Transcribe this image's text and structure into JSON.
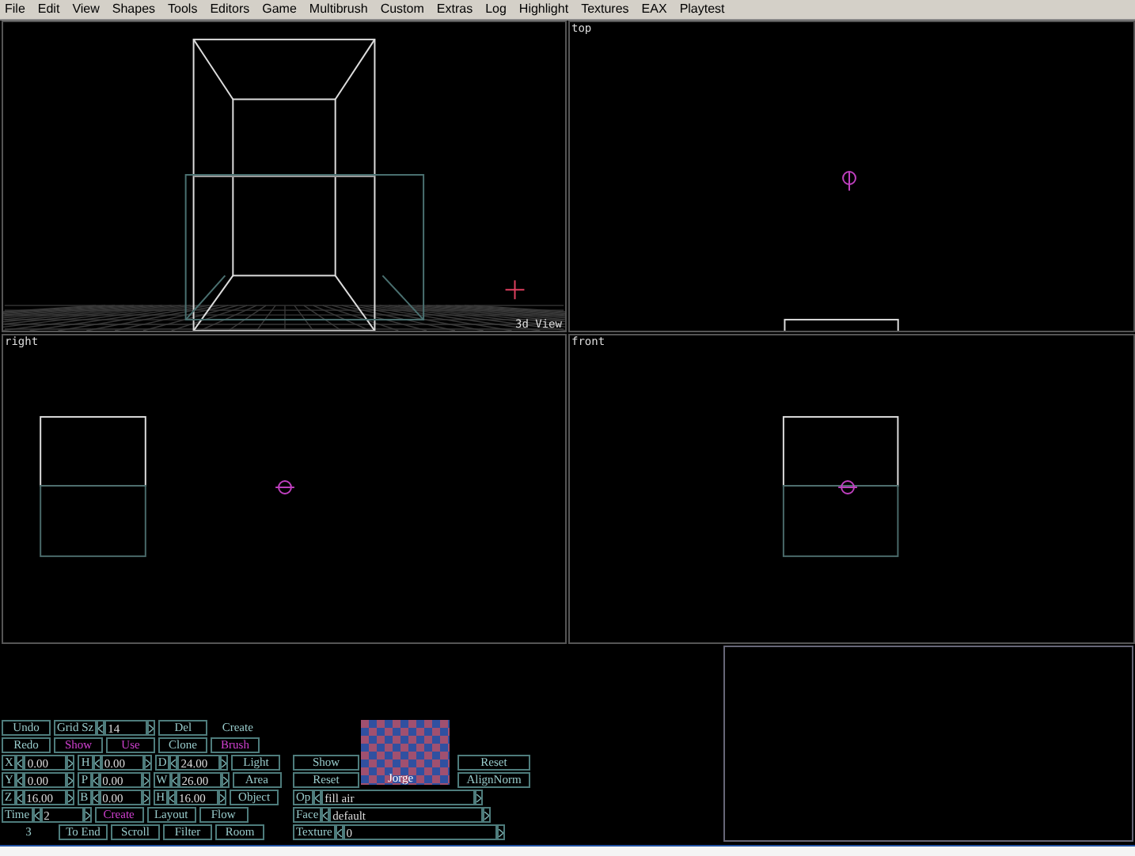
{
  "menu": [
    "File",
    "Edit",
    "View",
    "Shapes",
    "Tools",
    "Editors",
    "Game",
    "Multibrush",
    "Custom",
    "Extras",
    "Log",
    "Highlight",
    "Textures",
    "EAX",
    "Playtest"
  ],
  "viewports": [
    {
      "kind": "perspective",
      "label": "3d View"
    },
    {
      "kind": "top",
      "label": "top"
    },
    {
      "kind": "right",
      "label": "right"
    },
    {
      "kind": "front",
      "label": "front"
    }
  ],
  "controls": {
    "rows": [
      [
        {
          "kind": "button",
          "text": "Undo",
          "active": false
        },
        {
          "kind": "spinner",
          "label": "Grid Sz",
          "value": "14"
        },
        {
          "kind": "button",
          "text": "Del",
          "active": false
        },
        {
          "kind": "label",
          "text": "Create"
        }
      ],
      [
        {
          "kind": "button",
          "text": "Redo",
          "active": false
        },
        {
          "kind": "button",
          "text": "Show",
          "active": true
        },
        {
          "kind": "button",
          "text": "Use",
          "active": true
        },
        {
          "kind": "button",
          "text": "Clone",
          "active": false
        },
        {
          "kind": "button",
          "text": "Brush",
          "active": true
        }
      ],
      [
        {
          "kind": "spinner",
          "label": "X",
          "value": "0.00"
        },
        {
          "kind": "spinner",
          "label": "H",
          "value": "0.00"
        },
        {
          "kind": "spinner",
          "label": "D",
          "value": "24.00"
        },
        {
          "kind": "button",
          "text": "Light",
          "active": false
        }
      ],
      [
        {
          "kind": "spinner",
          "label": "Y",
          "value": "0.00"
        },
        {
          "kind": "spinner",
          "label": "P",
          "value": "0.00"
        },
        {
          "kind": "spinner",
          "label": "W",
          "value": "26.00"
        },
        {
          "kind": "button",
          "text": "Area",
          "active": false
        }
      ],
      [
        {
          "kind": "spinner",
          "label": "Z",
          "value": "16.00"
        },
        {
          "kind": "spinner",
          "label": "B",
          "value": "0.00"
        },
        {
          "kind": "spinner",
          "label": "H",
          "value": "16.00"
        },
        {
          "kind": "button",
          "text": "Object",
          "active": false
        }
      ],
      [
        {
          "kind": "spinner",
          "label": "Time",
          "value": "2"
        },
        {
          "kind": "button",
          "text": "Create",
          "active": true
        },
        {
          "kind": "button",
          "text": "Layout",
          "active": false
        },
        {
          "kind": "button",
          "text": "Flow",
          "active": false
        }
      ],
      [
        {
          "kind": "label",
          "text": "3"
        },
        {
          "kind": "button",
          "text": "To End",
          "active": false
        },
        {
          "kind": "button",
          "text": "Scroll",
          "active": false
        },
        {
          "kind": "button",
          "text": "Filter",
          "active": false
        },
        {
          "kind": "button",
          "text": "Room",
          "active": false
        }
      ]
    ],
    "texture": {
      "name": "Jorge"
    },
    "side_buttons": [
      "Show",
      "Reset"
    ],
    "align_buttons": [
      "Reset",
      "AlignNorm"
    ],
    "side_fields": [
      {
        "label": "Op",
        "value": "fill air"
      },
      {
        "label": "Face",
        "value": "default"
      },
      {
        "label": "Texture",
        "value": "0"
      }
    ]
  }
}
